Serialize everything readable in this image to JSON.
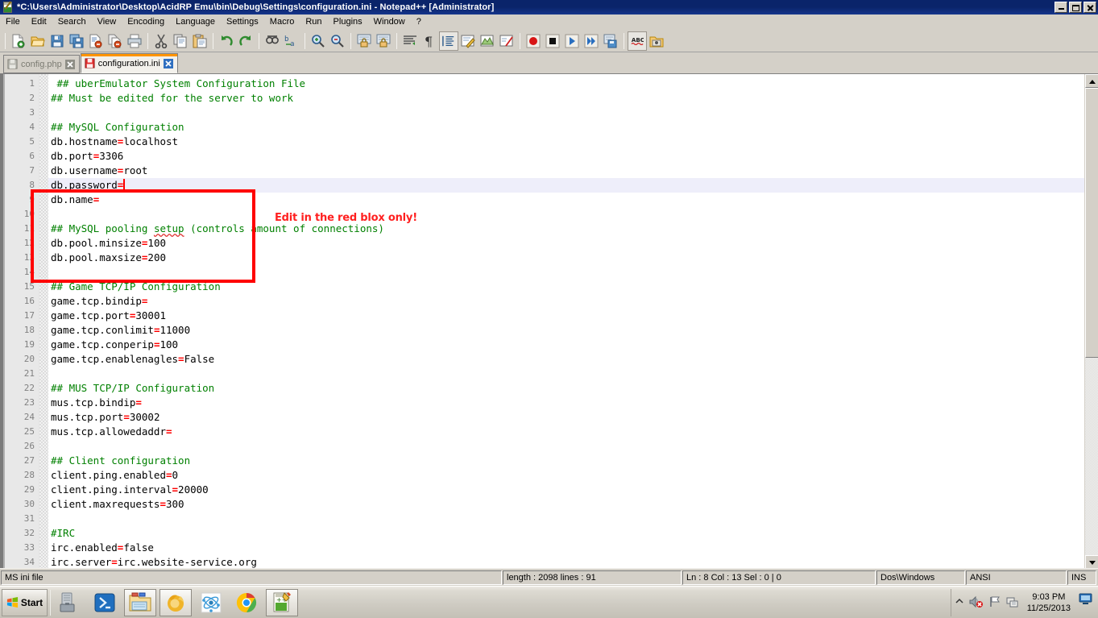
{
  "window": {
    "title": "*C:\\Users\\Administrator\\Desktop\\AcidRP Emu\\bin\\Debug\\Settings\\configuration.ini - Notepad++ [Administrator]",
    "icon": "notepadpp-icon",
    "controls": {
      "minimize": "Minimize",
      "restore": "Restore",
      "close": "Close"
    }
  },
  "menubar": {
    "items": [
      {
        "label": "File"
      },
      {
        "label": "Edit"
      },
      {
        "label": "Search"
      },
      {
        "label": "View"
      },
      {
        "label": "Encoding"
      },
      {
        "label": "Language"
      },
      {
        "label": "Settings"
      },
      {
        "label": "Macro"
      },
      {
        "label": "Run"
      },
      {
        "label": "Plugins"
      },
      {
        "label": "Window"
      },
      {
        "label": "?"
      }
    ]
  },
  "toolbar": {
    "buttons": [
      {
        "name": "new-icon"
      },
      {
        "name": "open-icon"
      },
      {
        "name": "save-icon"
      },
      {
        "name": "save-all-icon"
      },
      {
        "name": "close-icon"
      },
      {
        "name": "close-all-icon"
      },
      {
        "name": "print-icon"
      },
      {
        "name": "cut-icon"
      },
      {
        "name": "copy-icon"
      },
      {
        "name": "paste-icon"
      },
      {
        "name": "undo-icon"
      },
      {
        "name": "redo-icon"
      },
      {
        "name": "find-icon"
      },
      {
        "name": "replace-icon"
      },
      {
        "name": "zoom-in-icon"
      },
      {
        "name": "zoom-out-icon"
      },
      {
        "name": "sync-vertical-scroll-icon"
      },
      {
        "name": "sync-horizontal-scroll-icon"
      },
      {
        "name": "word-wrap-icon"
      },
      {
        "name": "show-all-characters-icon"
      },
      {
        "name": "indent-guide-icon"
      },
      {
        "name": "user-defined-language-icon"
      },
      {
        "name": "document-map-icon"
      },
      {
        "name": "function-list-icon"
      },
      {
        "name": "start-recording-icon"
      },
      {
        "name": "stop-recording-icon"
      },
      {
        "name": "play-macro-icon"
      },
      {
        "name": "run-macro-multiple-icon"
      },
      {
        "name": "save-macro-icon"
      },
      {
        "name": "spell-check-icon"
      },
      {
        "name": "folder-as-workspace-icon"
      }
    ]
  },
  "tabs": [
    {
      "label": "config.php",
      "active": false,
      "modified": false,
      "icon": "save-gray-icon",
      "close": "close-tab-icon"
    },
    {
      "label": "configuration.ini",
      "active": true,
      "modified": true,
      "icon": "save-red-icon",
      "close": "close-tab-icon"
    }
  ],
  "editor": {
    "current_line": 8,
    "caret_col": 13,
    "annotation": "Edit in the red blox only!",
    "annotation_color": "#ff2020",
    "redbox_color": "#ff0000",
    "current_line_bg": "#eeeefa",
    "comment_color": "#008000",
    "equals_color": "#ff0000",
    "lines": [
      {
        "n": 1,
        "type": "comment",
        "text": " ## uberEmulator System Configuration File"
      },
      {
        "n": 2,
        "type": "comment",
        "text": "## Must be edited for the server to work"
      },
      {
        "n": 3,
        "type": "blank",
        "text": ""
      },
      {
        "n": 4,
        "type": "comment",
        "text": "## MySQL Configuration"
      },
      {
        "n": 5,
        "type": "kv",
        "key": "db.hostname",
        "value": "localhost"
      },
      {
        "n": 6,
        "type": "kv",
        "key": "db.port",
        "value": "3306"
      },
      {
        "n": 7,
        "type": "kv",
        "key": "db.username",
        "value": "root"
      },
      {
        "n": 8,
        "type": "kv",
        "key": "db.password",
        "value": ""
      },
      {
        "n": 9,
        "type": "kv",
        "key": "db.name",
        "value": ""
      },
      {
        "n": 10,
        "type": "blank",
        "text": ""
      },
      {
        "n": 11,
        "type": "comment-spell",
        "text": "## MySQL pooling setup (controls amount of connections)",
        "misspelled": "setup"
      },
      {
        "n": 12,
        "type": "kv",
        "key": "db.pool.minsize",
        "value": "100"
      },
      {
        "n": 13,
        "type": "kv",
        "key": "db.pool.maxsize",
        "value": "200"
      },
      {
        "n": 14,
        "type": "blank",
        "text": ""
      },
      {
        "n": 15,
        "type": "comment",
        "text": "## Game TCP/IP Configuration"
      },
      {
        "n": 16,
        "type": "kv",
        "key": "game.tcp.bindip",
        "value": ""
      },
      {
        "n": 17,
        "type": "kv",
        "key": "game.tcp.port",
        "value": "30001"
      },
      {
        "n": 18,
        "type": "kv",
        "key": "game.tcp.conlimit",
        "value": "11000"
      },
      {
        "n": 19,
        "type": "kv",
        "key": "game.tcp.conperip",
        "value": "100"
      },
      {
        "n": 20,
        "type": "kv",
        "key": "game.tcp.enablenagles",
        "value": "False"
      },
      {
        "n": 21,
        "type": "blank",
        "text": ""
      },
      {
        "n": 22,
        "type": "comment",
        "text": "## MUS TCP/IP Configuration"
      },
      {
        "n": 23,
        "type": "kv",
        "key": "mus.tcp.bindip",
        "value": ""
      },
      {
        "n": 24,
        "type": "kv",
        "key": "mus.tcp.port",
        "value": "30002"
      },
      {
        "n": 25,
        "type": "kv",
        "key": "mus.tcp.allowedaddr",
        "value": ""
      },
      {
        "n": 26,
        "type": "blank",
        "text": ""
      },
      {
        "n": 27,
        "type": "comment",
        "text": "## Client configuration"
      },
      {
        "n": 28,
        "type": "kv",
        "key": "client.ping.enabled",
        "value": "0"
      },
      {
        "n": 29,
        "type": "kv",
        "key": "client.ping.interval",
        "value": "20000"
      },
      {
        "n": 30,
        "type": "kv",
        "key": "client.maxrequests",
        "value": "300"
      },
      {
        "n": 31,
        "type": "blank",
        "text": ""
      },
      {
        "n": 32,
        "type": "comment",
        "text": "#IRC"
      },
      {
        "n": 33,
        "type": "kv",
        "key": "irc.enabled",
        "value": "false"
      },
      {
        "n": 34,
        "type": "kv",
        "key": "irc.server",
        "value": "irc.website-service.org"
      }
    ]
  },
  "scrollbar": {
    "up_arrow": "scroll-up-icon",
    "down_arrow": "scroll-down-icon"
  },
  "statusbar": {
    "filetype": "MS ini file",
    "length_lines": "length : 2098   lines : 91",
    "position": "Ln : 8    Col : 13    Sel : 0 | 0",
    "eol": "Dos\\Windows",
    "encoding": "ANSI",
    "insert_mode": "INS"
  },
  "taskbar": {
    "start_label": "Start",
    "items": [
      {
        "name": "server-manager-icon",
        "active": false
      },
      {
        "name": "powershell-icon",
        "active": false
      },
      {
        "name": "file-explorer-icon",
        "active": true
      },
      {
        "name": "firefox-icon",
        "active": true
      },
      {
        "name": "atom-icon",
        "active": false
      },
      {
        "name": "chrome-icon",
        "active": false
      },
      {
        "name": "notepadpp-taskbar-icon",
        "active": true
      }
    ],
    "tray": [
      {
        "name": "show-hidden-icons-icon"
      },
      {
        "name": "volume-muted-icon"
      },
      {
        "name": "action-center-flag-icon"
      },
      {
        "name": "network-icon"
      }
    ],
    "clock": {
      "time": "9:03 PM",
      "date": "11/25/2013"
    },
    "show_desktop": "show-desktop-button"
  }
}
